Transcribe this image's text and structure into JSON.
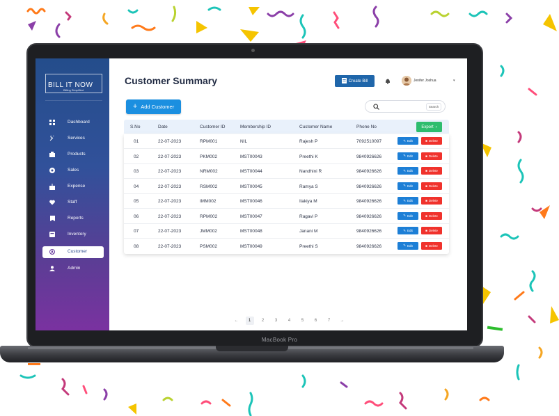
{
  "device": {
    "label": "MacBook Pro"
  },
  "sidebar": {
    "logo_title": "BILL IT NOW",
    "logo_subtitle": "Billing Simplified",
    "items": [
      {
        "label": "Dashboard",
        "icon": "dashboard-icon",
        "active": false
      },
      {
        "label": "Services",
        "icon": "services-icon",
        "active": false
      },
      {
        "label": "Products",
        "icon": "products-icon",
        "active": false
      },
      {
        "label": "Sales",
        "icon": "sales-icon",
        "active": false
      },
      {
        "label": "Expense",
        "icon": "expense-icon",
        "active": false
      },
      {
        "label": "Staff",
        "icon": "staff-icon",
        "active": false
      },
      {
        "label": "Reports",
        "icon": "reports-icon",
        "active": false
      },
      {
        "label": "Inventory",
        "icon": "inventory-icon",
        "active": false
      },
      {
        "label": "Customer",
        "icon": "customer-icon",
        "active": true
      },
      {
        "label": "Admin",
        "icon": "admin-icon",
        "active": false
      }
    ]
  },
  "header": {
    "title": "Customer Summary",
    "create_bill_label": "Create Bill",
    "user_name": "Jenifer Joshua"
  },
  "toolbar": {
    "add_customer_label": "Add Customer",
    "search_placeholder": "",
    "search_button_label": "Search"
  },
  "table": {
    "columns": [
      "S.No",
      "Date",
      "Customer ID",
      "Membership ID",
      "Customer Name",
      "Phone No"
    ],
    "export_label": "Export",
    "edit_label": "Edit",
    "delete_label": "Delete",
    "rows": [
      {
        "sno": "01",
        "date": "22-07-2023",
        "customer_id": "RPM001",
        "membership_id": "NIL",
        "name": "Rajesh P",
        "phone": "7092510097"
      },
      {
        "sno": "02",
        "date": "22-07-2023",
        "customer_id": "PKM002",
        "membership_id": "MST00043",
        "name": "Preethi K",
        "phone": "9840926626"
      },
      {
        "sno": "03",
        "date": "22-07-2023",
        "customer_id": "NRM002",
        "membership_id": "MST00044",
        "name": "Nandhini R",
        "phone": "9840926626"
      },
      {
        "sno": "04",
        "date": "22-07-2023",
        "customer_id": "RSM002",
        "membership_id": "MST00045",
        "name": "Ramya S",
        "phone": "9840926626"
      },
      {
        "sno": "05",
        "date": "22-07-2023",
        "customer_id": "IMM002",
        "membership_id": "MST00046",
        "name": "Ilakiya M",
        "phone": "9840926626"
      },
      {
        "sno": "06",
        "date": "22-07-2023",
        "customer_id": "RPM002",
        "membership_id": "MST00047",
        "name": "Ragavi P",
        "phone": "9840926626"
      },
      {
        "sno": "07",
        "date": "22-07-2023",
        "customer_id": "JMM002",
        "membership_id": "MST00048",
        "name": "Janani M",
        "phone": "9840926626"
      },
      {
        "sno": "08",
        "date": "22-07-2023",
        "customer_id": "PSM002",
        "membership_id": "MST00049",
        "name": "Preethi S",
        "phone": "9840926626"
      }
    ]
  },
  "pagination": {
    "prev": "←",
    "next": "→",
    "pages": [
      "1",
      "2",
      "3",
      "4",
      "5",
      "6",
      "7"
    ],
    "current": "1"
  },
  "colors": {
    "sidebar_top": "#244d8b",
    "sidebar_bottom": "#7a32a0",
    "primary": "#1b8fe0",
    "create_bill": "#1f66aa",
    "export": "#2dbd6e",
    "edit": "#1d7fd6",
    "delete": "#f0322c"
  }
}
